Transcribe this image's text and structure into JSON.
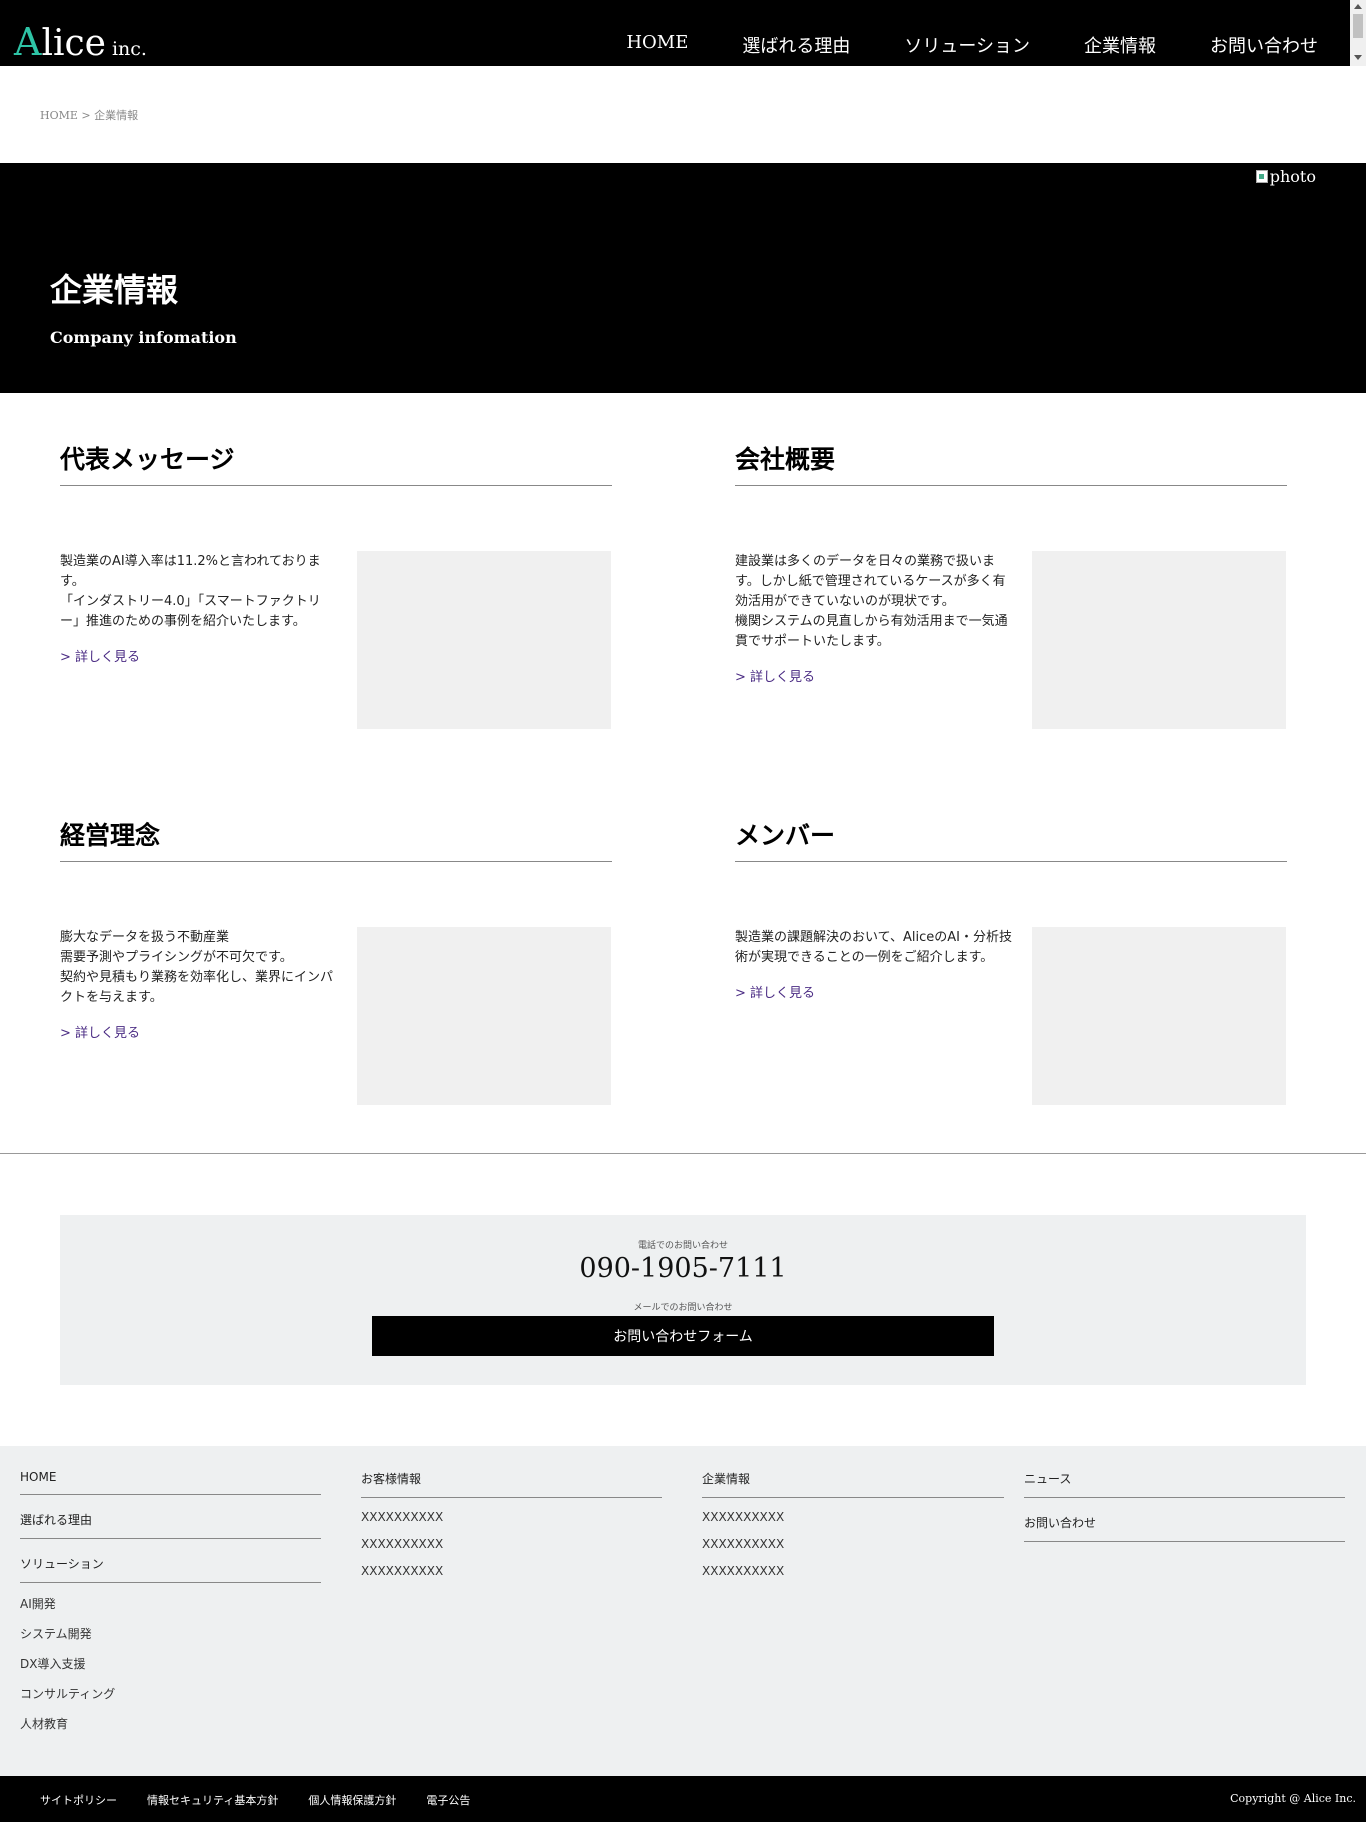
{
  "header": {
    "logo_a": "A",
    "logo_rest": "lice",
    "logo_inc": "inc.",
    "nav": [
      "HOME",
      "選ばれる理由",
      "ソリューション",
      "企業情報",
      "お問い合わせ"
    ]
  },
  "breadcrumb": "HOME > 企業情報",
  "hero": {
    "photo_alt": "photo",
    "title": "企業情報",
    "subtitle": "Company infomation"
  },
  "sections": [
    {
      "title": "代表メッセージ",
      "lines": [
        "製造業のAI導入率は11.2%と言われております。",
        "「インダストリー4.0」「スマートファクトリー」推進のための事例を紹介いたします。"
      ],
      "more": "> 詳しく見る"
    },
    {
      "title": "会社概要",
      "lines": [
        "建設業は多くのデータを日々の業務で扱います。しかし紙で管理されているケースが多く有効活用ができていないのが現状です。",
        "機関システムの見直しから有効活用まで一気通貫でサポートいたします。"
      ],
      "more": "> 詳しく見る"
    },
    {
      "title": "経営理念",
      "lines": [
        "膨大なデータを扱う不動産業",
        "需要予測やプライシングが不可欠です。",
        "契約や見積もり業務を効率化し、業界にインパクトを与えます。"
      ],
      "more": "> 詳しく見る"
    },
    {
      "title": "メンバー",
      "lines": [
        "製造業の課題解決のおいて、AliceのAI・分析技術が実現できることの一例をご紹介します。"
      ],
      "more": "> 詳しく見る"
    }
  ],
  "contact": {
    "phone_label": "電話でのお問い合わせ",
    "phone": "090-1905-7111",
    "mail_label": "メールでのお問い合わせ",
    "form_button": "お問い合わせフォーム"
  },
  "footer": {
    "col1": {
      "home": "HOME",
      "reason": "選ばれる理由",
      "solution": "ソリューション",
      "items": [
        "AI開発",
        "システム開発",
        "DX導入支援",
        "コンサルティング",
        "人材教育"
      ]
    },
    "col2": {
      "head": "お客様情報",
      "items": [
        "XXXXXXXXXX",
        "XXXXXXXXXX",
        "XXXXXXXXXX"
      ]
    },
    "col3": {
      "head": "企業情報",
      "items": [
        "XXXXXXXXXX",
        "XXXXXXXXXX",
        "XXXXXXXXXX"
      ]
    },
    "col4": {
      "news": "ニュース",
      "contact": "お問い合わせ"
    }
  },
  "bottom": {
    "links": [
      "サイトポリシー",
      "情報セキュリティ基本方針",
      "個人情報保護方針",
      "電子公告"
    ],
    "copyright": "Copyright @ Alice Inc."
  }
}
